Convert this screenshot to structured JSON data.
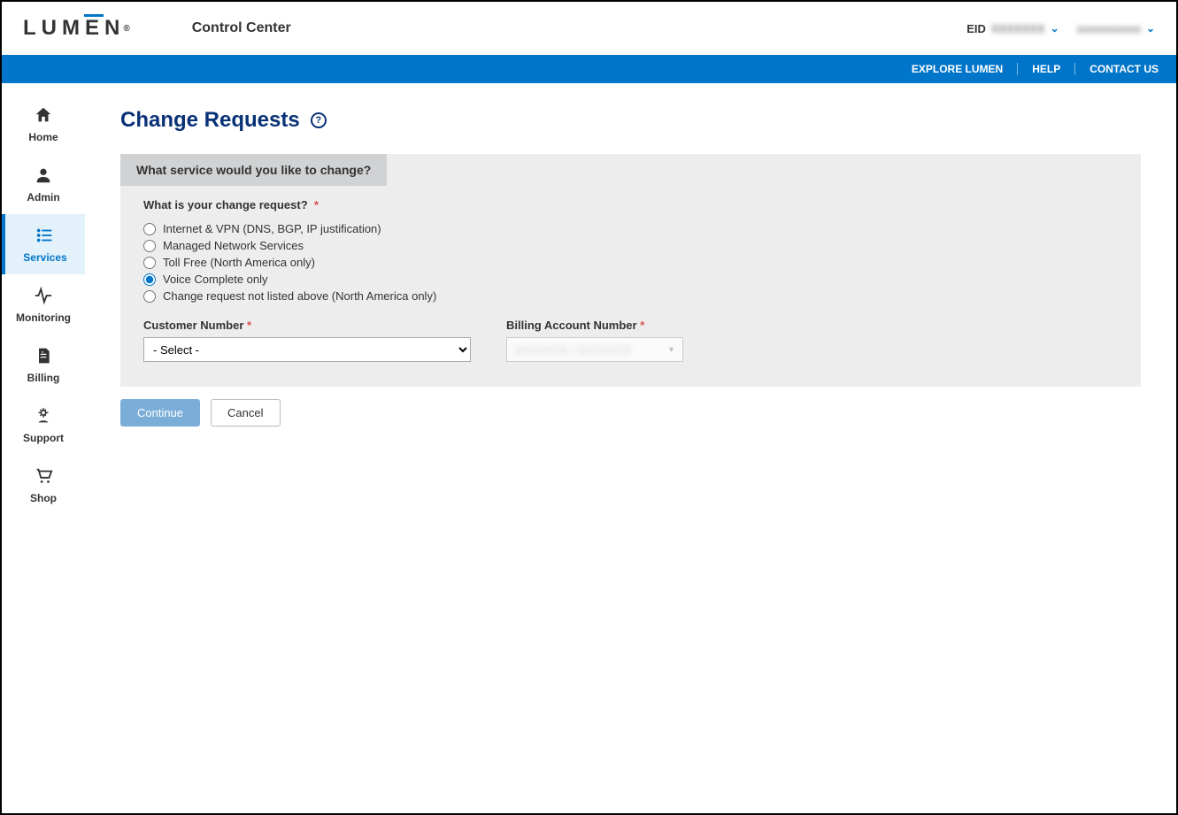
{
  "brand": "LUMEN",
  "app_title": "Control Center",
  "header": {
    "eid_label": "EID",
    "eid_value": "XXXXXXX",
    "username": "xxxxxxxxxx"
  },
  "bluebar": {
    "explore": "EXPLORE LUMEN",
    "help": "HELP",
    "contact": "CONTACT US"
  },
  "sidebar": {
    "home": "Home",
    "admin": "Admin",
    "services": "Services",
    "monitoring": "Monitoring",
    "billing": "Billing",
    "support": "Support",
    "shop": "Shop"
  },
  "page": {
    "title": "Change Requests",
    "panel_header": "What service would you like to change?",
    "question": "What is your change request?",
    "options": {
      "opt0": "Internet & VPN (DNS, BGP, IP justification)",
      "opt1": "Managed Network Services",
      "opt2": "Toll Free (North America only)",
      "opt3": "Voice Complete only",
      "opt4": "Change request not listed above (North America only)"
    },
    "selected_option_index": 3,
    "customer_number_label": "Customer Number",
    "billing_account_label": "Billing Account Number",
    "customer_select_value": "- Select -",
    "billing_value": "XXXXXXX / XXXXXXX",
    "continue": "Continue",
    "cancel": "Cancel"
  }
}
